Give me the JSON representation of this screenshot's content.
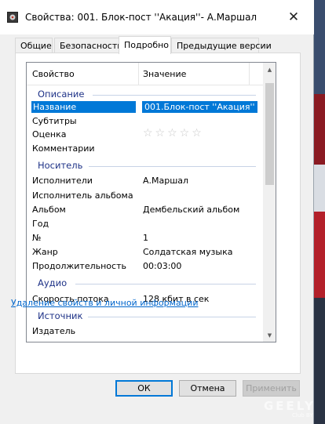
{
  "window": {
    "title": "Свойства: 001. Блок-пост ''Акация''- А.Маршал",
    "close_glyph": "✕"
  },
  "tabs": [
    {
      "label": "Общие"
    },
    {
      "label": "Безопасность"
    },
    {
      "label": "Подробно",
      "active": true
    },
    {
      "label": "Предыдущие версии"
    }
  ],
  "columns": {
    "property": "Свойство",
    "value": "Значение"
  },
  "groups": {
    "description": "Описание",
    "media": "Носитель",
    "audio": "Аудио",
    "source": "Источник"
  },
  "rows": {
    "title": {
      "key": "Название",
      "value": "001.Блок-пост ''Акация''"
    },
    "subtitle": {
      "key": "Субтитры",
      "value": ""
    },
    "rating": {
      "key": "Оценка",
      "stars": "☆☆☆☆☆",
      "rating_value": 0
    },
    "comments": {
      "key": "Комментарии",
      "value": ""
    },
    "artists": {
      "key": "Исполнители",
      "value": "А.Маршал"
    },
    "album_artist": {
      "key": "Исполнитель альбома",
      "value": ""
    },
    "album": {
      "key": "Альбом",
      "value": "Дембельский альбом"
    },
    "year": {
      "key": "Год",
      "value": ""
    },
    "track": {
      "key": "№",
      "value": "1"
    },
    "genre": {
      "key": "Жанр",
      "value": "Солдатская музыка"
    },
    "length": {
      "key": "Продолжительность",
      "value": "00:03:00"
    },
    "bitrate": {
      "key": "Скорость потока",
      "value": "128 кбит в сек"
    },
    "publisher": {
      "key": "Издатель",
      "value": ""
    }
  },
  "link_remove": "Удаление свойств и личной информации",
  "buttons": {
    "ok": "ОК",
    "cancel": "Отмена",
    "apply": "Применить"
  },
  "watermark": {
    "brand": "GEELY",
    "sub": "Club BY"
  },
  "colors": {
    "accent": "#0078d7",
    "group_text": "#1e3287",
    "link": "#0066cc"
  }
}
